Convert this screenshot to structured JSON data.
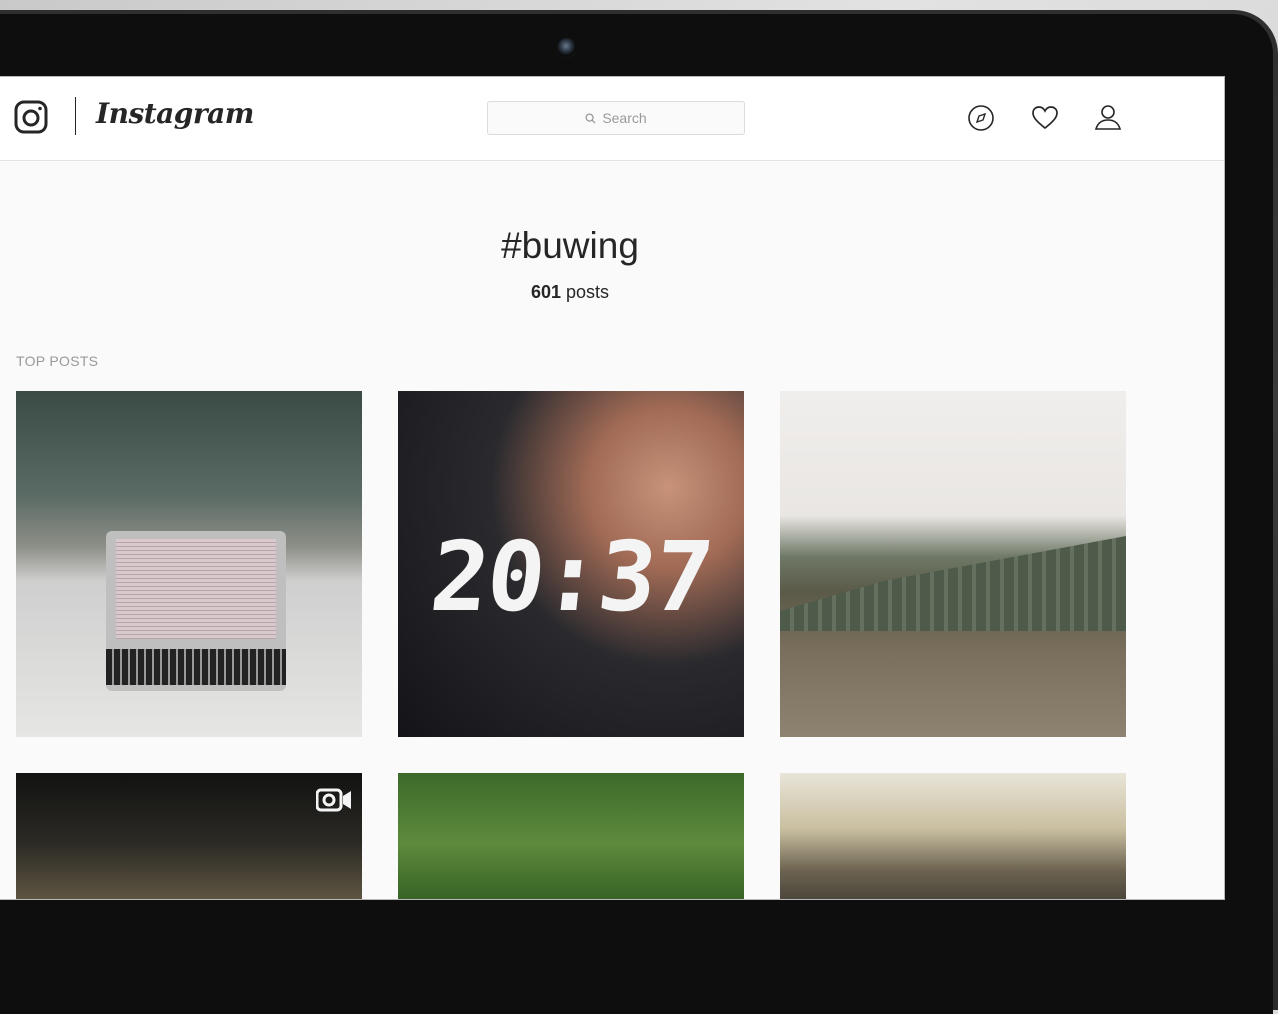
{
  "header": {
    "wordmark": "Instagram",
    "search": {
      "placeholder": "Search"
    }
  },
  "hashtag": {
    "title": "#buwing",
    "post_count": "601",
    "post_count_suffix": "posts"
  },
  "section": {
    "top_posts_label": "TOP POSTS"
  },
  "posts": [
    {
      "name": "post-library-laptop"
    },
    {
      "name": "post-clock-selfie",
      "overlay_text": "20:37"
    },
    {
      "name": "post-library-exterior"
    },
    {
      "name": "post-night-building",
      "is_video": true
    },
    {
      "name": "post-grass-group"
    },
    {
      "name": "post-ornate-ceiling"
    }
  ],
  "colors": {
    "text": "#262626",
    "muted": "#999999",
    "border": "#dbdbdb",
    "background": "#fafafa"
  },
  "icons": [
    "instagram-camera-icon",
    "search-icon",
    "compass-icon",
    "heart-icon",
    "profile-icon",
    "video-icon"
  ]
}
